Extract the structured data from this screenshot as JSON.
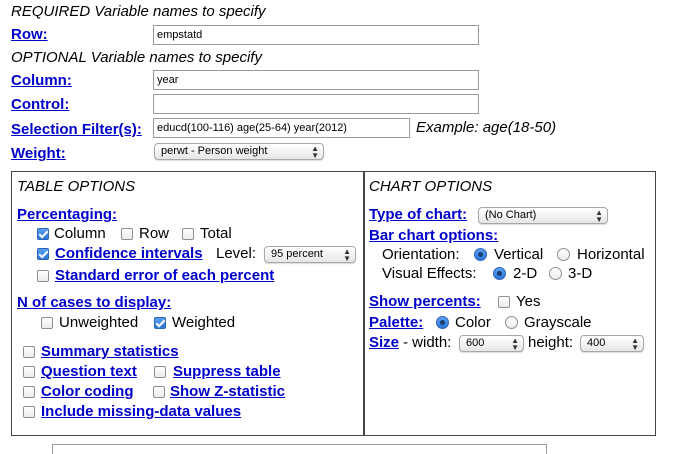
{
  "required_heading": "REQUIRED Variable names to specify",
  "optional_heading": "OPTIONAL Variable names to specify",
  "fields": {
    "row": {
      "label": "Row:",
      "value": "empstatd"
    },
    "column": {
      "label": "Column:",
      "value": "year"
    },
    "control": {
      "label": "Control:",
      "value": ""
    },
    "filter": {
      "label": "Selection Filter(s):",
      "value": "educd(100-116) age(25-64) year(2012)",
      "example": "Example: age(18-50)"
    },
    "weight": {
      "label": "Weight:",
      "selected": "perwt - Person weight"
    }
  },
  "table_options": {
    "heading": "TABLE OPTIONS",
    "percentaging": {
      "label": "Percentaging:",
      "column": {
        "label": "Column",
        "checked": true
      },
      "row": {
        "label": "Row",
        "checked": false
      },
      "total": {
        "label": "Total",
        "checked": false
      }
    },
    "confidence": {
      "label": "Confidence intervals",
      "checked": true,
      "level_label": "Level:",
      "level_selected": "95 percent"
    },
    "std_error": {
      "label": "Standard error of each percent",
      "checked": false
    },
    "n_cases": {
      "label": "N of cases to display:",
      "unweighted": {
        "label": "Unweighted",
        "checked": false
      },
      "weighted": {
        "label": "Weighted",
        "checked": true
      }
    },
    "summary_stats": {
      "label": "Summary statistics",
      "checked": false
    },
    "question_text": {
      "label": "Question text",
      "checked": false
    },
    "suppress_table": {
      "label": "Suppress table",
      "checked": false
    },
    "color_coding": {
      "label": "Color coding",
      "checked": false
    },
    "z_statistic": {
      "label": "Show Z-statistic",
      "checked": false
    },
    "missing_data": {
      "label": "Include missing-data values",
      "checked": false
    }
  },
  "chart_options": {
    "heading": "CHART OPTIONS",
    "type_label": "Type of chart:",
    "type_selected": "(No Chart)",
    "bar_label": "Bar chart options:",
    "orientation_label": "Orientation:",
    "vertical": {
      "label": "Vertical",
      "selected": true
    },
    "horizontal": {
      "label": "Horizontal",
      "selected": false
    },
    "effects_label": "Visual Effects:",
    "two_d": {
      "label": "2-D",
      "selected": true
    },
    "three_d": {
      "label": "3-D",
      "selected": false
    },
    "show_percents_label": "Show percents:",
    "yes": {
      "label": "Yes",
      "checked": false
    },
    "palette_label": "Palette:",
    "color": {
      "label": "Color",
      "selected": true
    },
    "grayscale": {
      "label": "Grayscale",
      "selected": false
    },
    "size_label": "Size",
    "width_label": "- width:",
    "width_selected": "600",
    "height_label": "height:",
    "height_selected": "400"
  }
}
